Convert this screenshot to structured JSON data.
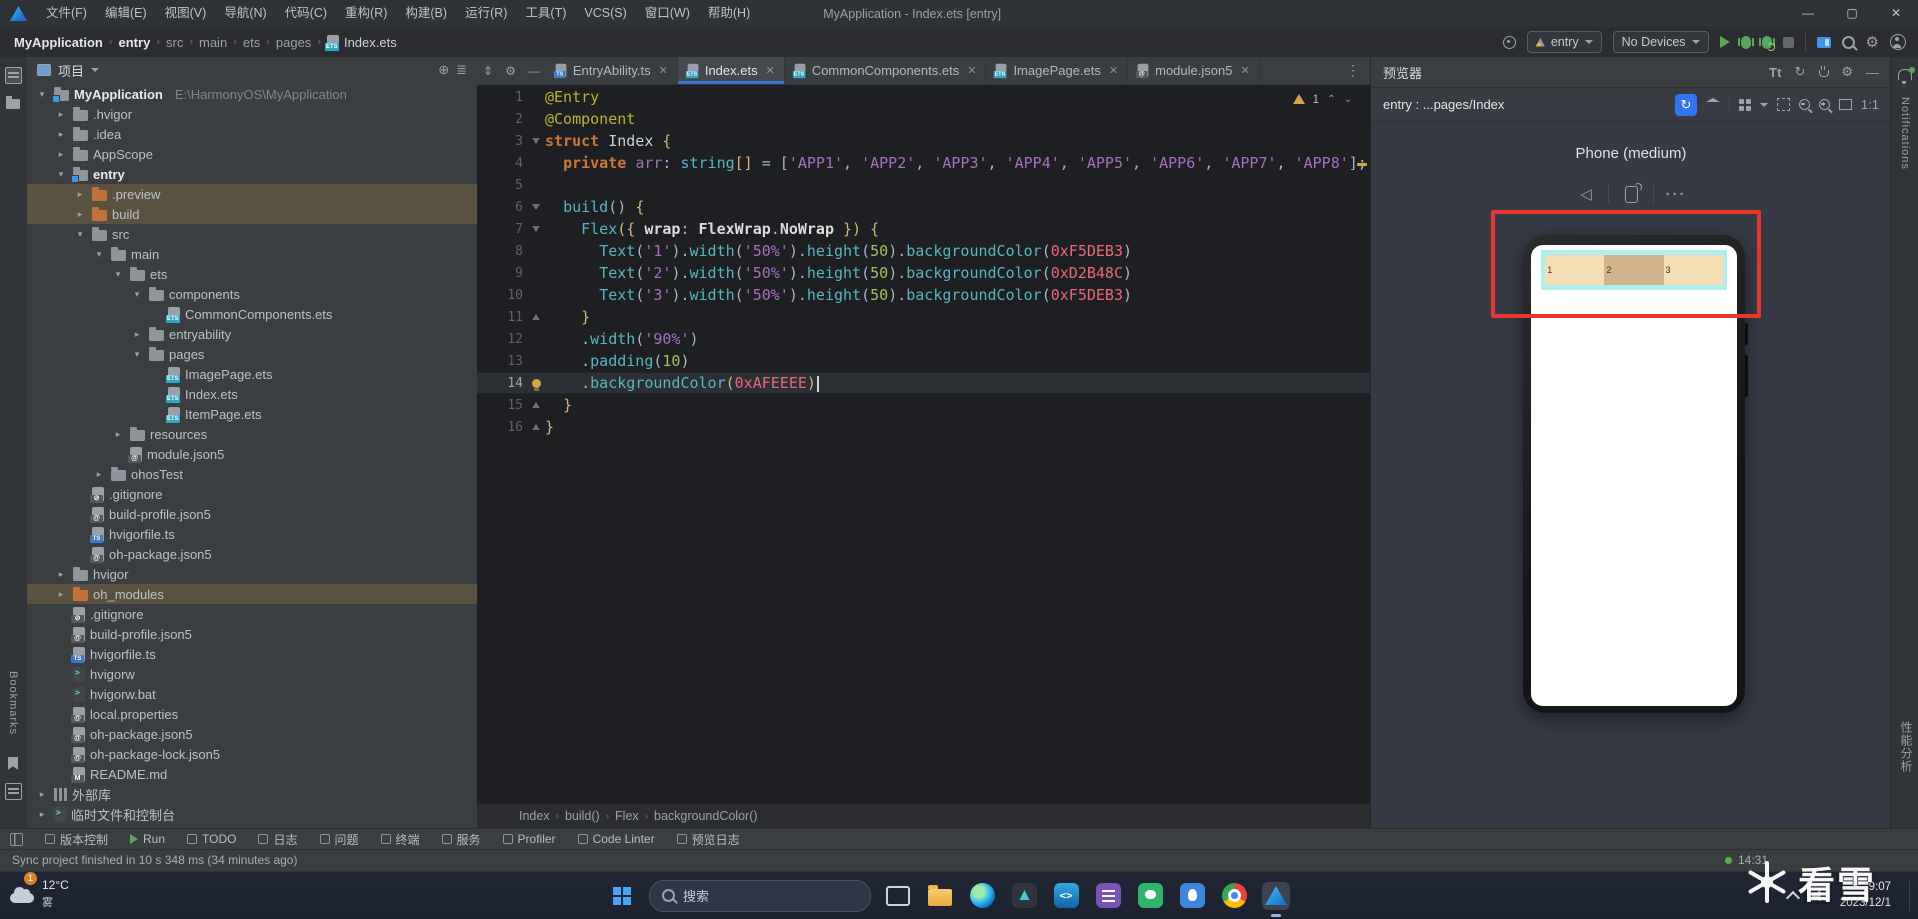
{
  "app": {
    "title": "MyApplication - Index.ets [entry]",
    "menus": [
      "文件(F)",
      "编辑(E)",
      "视图(V)",
      "导航(N)",
      "代码(C)",
      "重构(R)",
      "构建(B)",
      "运行(R)",
      "工具(T)",
      "VCS(S)",
      "窗口(W)",
      "帮助(H)"
    ],
    "window_controls": {
      "minimize": "—",
      "maximize": "▢",
      "close": "✕"
    }
  },
  "toolbar": {
    "breadcrumbs": [
      {
        "label": "MyApplication",
        "bold": true
      },
      {
        "label": "entry",
        "bold": true
      },
      {
        "label": "src"
      },
      {
        "label": "main"
      },
      {
        "label": "ets"
      },
      {
        "label": "pages"
      },
      {
        "label": "Index.ets",
        "file": true
      }
    ],
    "run_target": "entry",
    "device": "No Devices"
  },
  "left_stripe": {
    "bookmarks_label": "Bookmarks"
  },
  "project": {
    "title": "项目",
    "tree": [
      {
        "label": "MyApplication",
        "suffix": "E:\\HarmonyOS\\MyApplication",
        "level": 0,
        "icon": "folder-module",
        "chev": "open",
        "bold": true
      },
      {
        "label": ".hvigor",
        "level": 1,
        "icon": "folder",
        "chev": "closed"
      },
      {
        "label": ".idea",
        "level": 1,
        "icon": "folder",
        "chev": "closed"
      },
      {
        "label": "AppScope",
        "level": 1,
        "icon": "folder",
        "chev": "closed"
      },
      {
        "label": "entry",
        "level": 1,
        "icon": "folder-module",
        "chev": "open",
        "bold": true
      },
      {
        "label": ".preview",
        "level": 2,
        "icon": "folder-ex",
        "chev": "closed",
        "hl": true
      },
      {
        "label": "build",
        "level": 2,
        "icon": "folder-ex",
        "chev": "closed",
        "hl": true
      },
      {
        "label": "src",
        "level": 2,
        "icon": "folder",
        "chev": "open"
      },
      {
        "label": "main",
        "level": 3,
        "icon": "folder",
        "chev": "open"
      },
      {
        "label": "ets",
        "level": 4,
        "icon": "folder",
        "chev": "open"
      },
      {
        "label": "components",
        "level": 5,
        "icon": "folder",
        "chev": "open"
      },
      {
        "label": "CommonComponents.ets",
        "level": 6,
        "icon": "ets"
      },
      {
        "label": "entryability",
        "level": 5,
        "icon": "folder",
        "chev": "closed"
      },
      {
        "label": "pages",
        "level": 5,
        "icon": "folder",
        "chev": "open"
      },
      {
        "label": "ImagePage.ets",
        "level": 6,
        "icon": "ets"
      },
      {
        "label": "Index.ets",
        "level": 6,
        "icon": "ets"
      },
      {
        "label": "ItemPage.ets",
        "level": 6,
        "icon": "ets"
      },
      {
        "label": "resources",
        "level": 4,
        "icon": "folder",
        "chev": "closed"
      },
      {
        "label": "module.json5",
        "level": 4,
        "icon": "json"
      },
      {
        "label": "ohosTest",
        "level": 3,
        "icon": "folder",
        "chev": "closed"
      },
      {
        "label": ".gitignore",
        "level": 2,
        "icon": "ignore"
      },
      {
        "label": "build-profile.json5",
        "level": 2,
        "icon": "json"
      },
      {
        "label": "hvigorfile.ts",
        "level": 2,
        "icon": "ts"
      },
      {
        "label": "oh-package.json5",
        "level": 2,
        "icon": "json"
      },
      {
        "label": "hvigor",
        "level": 1,
        "icon": "folder",
        "chev": "closed"
      },
      {
        "label": "oh_modules",
        "level": 1,
        "icon": "folder-ex",
        "chev": "closed",
        "hl": true
      },
      {
        "label": ".gitignore",
        "level": 1,
        "icon": "ignore"
      },
      {
        "label": "build-profile.json5",
        "level": 1,
        "icon": "json"
      },
      {
        "label": "hvigorfile.ts",
        "level": 1,
        "icon": "ts"
      },
      {
        "label": "hvigorw",
        "level": 1,
        "icon": "console"
      },
      {
        "label": "hvigorw.bat",
        "level": 1,
        "icon": "console"
      },
      {
        "label": "local.properties",
        "level": 1,
        "icon": "json"
      },
      {
        "label": "oh-package.json5",
        "level": 1,
        "icon": "json"
      },
      {
        "label": "oh-package-lock.json5",
        "level": 1,
        "icon": "json"
      },
      {
        "label": "README.md",
        "level": 1,
        "icon": "md"
      },
      {
        "label": "外部库",
        "level": 0,
        "icon": "lib",
        "chev": "closed"
      },
      {
        "label": "临时文件和控制台",
        "level": 0,
        "icon": "console",
        "chev": "closed"
      }
    ]
  },
  "editor": {
    "tabs": [
      {
        "label": "EntryAbility.ts",
        "icon": "ts"
      },
      {
        "label": "Index.ets",
        "icon": "ets",
        "active": true
      },
      {
        "label": "CommonComponents.ets",
        "icon": "ets"
      },
      {
        "label": "ImagePage.ets",
        "icon": "ets"
      },
      {
        "label": "module.json5",
        "icon": "json"
      }
    ],
    "warning_count": "1",
    "current_line": 14,
    "lines": [
      {
        "n": 1,
        "tokens": [
          [
            "d",
            "@Entry"
          ]
        ]
      },
      {
        "n": 2,
        "tokens": [
          [
            "d",
            "@Component"
          ]
        ]
      },
      {
        "n": 3,
        "fold": "down",
        "tokens": [
          [
            "k",
            "struct"
          ],
          [
            "p",
            " "
          ],
          [
            "c",
            "Index"
          ],
          [
            "p",
            " "
          ],
          [
            "b",
            "{"
          ]
        ]
      },
      {
        "n": 4,
        "tokens": [
          [
            "p",
            "  "
          ],
          [
            "k",
            "private"
          ],
          [
            "p",
            " "
          ],
          [
            "f",
            "arr"
          ],
          [
            "p",
            ": "
          ],
          [
            "t",
            "string"
          ],
          [
            "b",
            "[]"
          ],
          [
            "p",
            " = ["
          ],
          [
            "s",
            "'APP1'"
          ],
          [
            "p",
            ", "
          ],
          [
            "s",
            "'APP2'"
          ],
          [
            "p",
            ", "
          ],
          [
            "s",
            "'APP3'"
          ],
          [
            "p",
            ", "
          ],
          [
            "s",
            "'APP4'"
          ],
          [
            "p",
            ", "
          ],
          [
            "s",
            "'APP5'"
          ],
          [
            "p",
            ", "
          ],
          [
            "s",
            "'APP6'"
          ],
          [
            "p",
            ", "
          ],
          [
            "s",
            "'APP7'"
          ],
          [
            "p",
            ", "
          ],
          [
            "s",
            "'APP8'"
          ],
          [
            "p",
            "];"
          ]
        ]
      },
      {
        "n": 5,
        "tokens": []
      },
      {
        "n": 6,
        "fold": "down",
        "tokens": [
          [
            "p",
            "  "
          ],
          [
            "m",
            "build"
          ],
          [
            "p",
            "() "
          ],
          [
            "b",
            "{"
          ]
        ]
      },
      {
        "n": 7,
        "fold": "down",
        "tokens": [
          [
            "p",
            "    "
          ],
          [
            "m",
            "Flex"
          ],
          [
            "b",
            "({ "
          ],
          [
            "w",
            "wrap"
          ],
          [
            "p",
            ": "
          ],
          [
            "w",
            "FlexWrap"
          ],
          [
            "p",
            "."
          ],
          [
            "w",
            "NoWrap"
          ],
          [
            "b",
            " }) {"
          ]
        ]
      },
      {
        "n": 8,
        "tokens": [
          [
            "p",
            "      "
          ],
          [
            "m",
            "Text"
          ],
          [
            "p",
            "("
          ],
          [
            "s",
            "'1'"
          ],
          [
            "p",
            ")."
          ],
          [
            "m",
            "width"
          ],
          [
            "p",
            "("
          ],
          [
            "s",
            "'50%'"
          ],
          [
            "p",
            ")."
          ],
          [
            "m",
            "height"
          ],
          [
            "p",
            "("
          ],
          [
            "n",
            "50"
          ],
          [
            "p",
            ")."
          ],
          [
            "m",
            "backgroundColor"
          ],
          [
            "p",
            "("
          ],
          [
            "x",
            "0xF5DEB3"
          ],
          [
            "p",
            ")"
          ]
        ]
      },
      {
        "n": 9,
        "tokens": [
          [
            "p",
            "      "
          ],
          [
            "m",
            "Text"
          ],
          [
            "p",
            "("
          ],
          [
            "s",
            "'2'"
          ],
          [
            "p",
            ")."
          ],
          [
            "m",
            "width"
          ],
          [
            "p",
            "("
          ],
          [
            "s",
            "'50%'"
          ],
          [
            "p",
            ")."
          ],
          [
            "m",
            "height"
          ],
          [
            "p",
            "("
          ],
          [
            "n",
            "50"
          ],
          [
            "p",
            ")."
          ],
          [
            "m",
            "backgroundColor"
          ],
          [
            "p",
            "("
          ],
          [
            "x",
            "0xD2B48C"
          ],
          [
            "p",
            ")"
          ]
        ]
      },
      {
        "n": 10,
        "tokens": [
          [
            "p",
            "      "
          ],
          [
            "m",
            "Text"
          ],
          [
            "p",
            "("
          ],
          [
            "s",
            "'3'"
          ],
          [
            "p",
            ")."
          ],
          [
            "m",
            "width"
          ],
          [
            "p",
            "("
          ],
          [
            "s",
            "'50%'"
          ],
          [
            "p",
            ")."
          ],
          [
            "m",
            "height"
          ],
          [
            "p",
            "("
          ],
          [
            "n",
            "50"
          ],
          [
            "p",
            ")."
          ],
          [
            "m",
            "backgroundColor"
          ],
          [
            "p",
            "("
          ],
          [
            "x",
            "0xF5DEB3"
          ],
          [
            "p",
            ")"
          ]
        ]
      },
      {
        "n": 11,
        "fold": "up",
        "tokens": [
          [
            "p",
            "    "
          ],
          [
            "b",
            "}"
          ]
        ]
      },
      {
        "n": 12,
        "tokens": [
          [
            "p",
            "    ."
          ],
          [
            "m",
            "width"
          ],
          [
            "p",
            "("
          ],
          [
            "s",
            "'90%'"
          ],
          [
            "p",
            ")"
          ]
        ]
      },
      {
        "n": 13,
        "tokens": [
          [
            "p",
            "    ."
          ],
          [
            "m",
            "padding"
          ],
          [
            "p",
            "("
          ],
          [
            "n",
            "10"
          ],
          [
            "p",
            ")"
          ]
        ]
      },
      {
        "n": 14,
        "bulb": true,
        "caret": true,
        "tokens": [
          [
            "p",
            "    ."
          ],
          [
            "m",
            "backgroundColor"
          ],
          [
            "b",
            "("
          ],
          [
            "x",
            "0xAFEEEE"
          ],
          [
            "b",
            ")"
          ]
        ]
      },
      {
        "n": 15,
        "fold": "up",
        "tokens": [
          [
            "p",
            "  "
          ],
          [
            "b",
            "}"
          ]
        ]
      },
      {
        "n": 16,
        "fold": "up",
        "tokens": [
          [
            "b",
            "}"
          ]
        ]
      }
    ],
    "breadcrumb": [
      "Index",
      "build()",
      "Flex",
      "backgroundColor()"
    ]
  },
  "previewer": {
    "title": "预览器",
    "target": "entry : ...pages/Index",
    "device": "Phone (medium)",
    "zoom": "1:1",
    "flex_bg": "#AFEEEE",
    "boxes": [
      {
        "label": "1",
        "color": "#F5DEB3"
      },
      {
        "label": "2",
        "color": "#D2B48C"
      },
      {
        "label": "3",
        "color": "#F5DEB3"
      }
    ],
    "annotation_color": "#E5372B"
  },
  "right_stripe": {
    "notifications": "Notifications",
    "profiler": "性能分析"
  },
  "bottom_bar": {
    "items": [
      {
        "label": "版本控制",
        "icon": "vcs"
      },
      {
        "label": "Run",
        "icon": "run"
      },
      {
        "label": "TODO",
        "icon": "todo"
      },
      {
        "label": "日志",
        "icon": "log"
      },
      {
        "label": "问题",
        "icon": "problem"
      },
      {
        "label": "终端",
        "icon": "terminal"
      },
      {
        "label": "服务",
        "icon": "services"
      },
      {
        "label": "Profiler",
        "icon": "profiler"
      },
      {
        "label": "Code Linter",
        "icon": "linter"
      },
      {
        "label": "预览日志",
        "icon": "preview-log"
      }
    ]
  },
  "status_bar": {
    "message": "Sync project finished in 10 s 348 ms (34 minutes ago)",
    "time": "14:31"
  },
  "taskbar": {
    "weather_temp": "12°C",
    "weather_cond": "雾",
    "weather_badge": "1",
    "search_placeholder": "搜索",
    "icons": [
      "task-view",
      "explorer",
      "edge",
      "dark-app",
      "vscode",
      "reader",
      "green-app",
      "blue-app",
      "chrome",
      "deveco"
    ],
    "time": "9:07",
    "date": "2023/12/1"
  },
  "watermark": {
    "text": "看雪"
  }
}
